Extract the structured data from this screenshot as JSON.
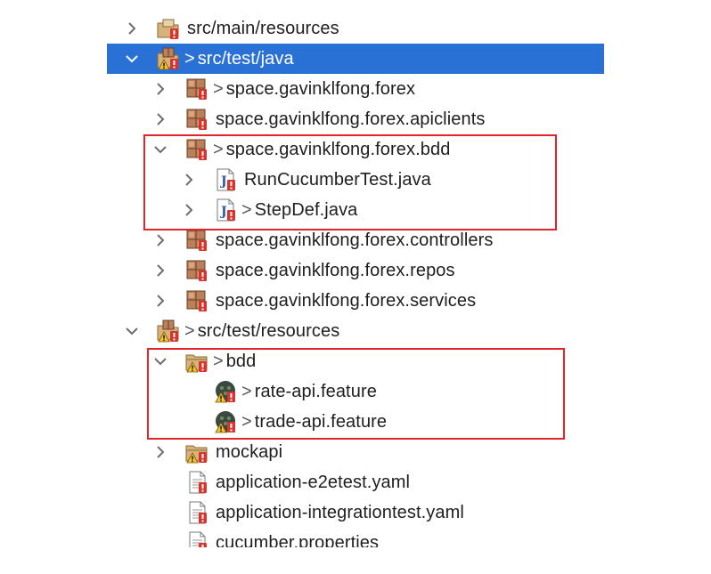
{
  "tree": {
    "rows": [
      {
        "label": "src/main/resources",
        "prefix": "",
        "chevron": "right",
        "icon": "folder-resources-icon",
        "depth": 1,
        "selected": false
      },
      {
        "label": "src/test/java",
        "prefix": ">",
        "chevron": "down",
        "icon": "source-folder-icon",
        "depth": 1,
        "selected": true
      },
      {
        "label": "space.gavinklfong.forex",
        "prefix": ">",
        "chevron": "right",
        "icon": "package-icon",
        "depth": 2,
        "selected": false
      },
      {
        "label": "space.gavinklfong.forex.apiclients",
        "prefix": "",
        "chevron": "right",
        "icon": "package-icon",
        "depth": 2,
        "selected": false
      },
      {
        "label": "space.gavinklfong.forex.bdd",
        "prefix": ">",
        "chevron": "down",
        "icon": "package-icon",
        "depth": 2,
        "selected": false
      },
      {
        "label": "RunCucumberTest.java",
        "prefix": "",
        "chevron": "right",
        "icon": "java-file-icon",
        "depth": 3,
        "selected": false
      },
      {
        "label": "StepDef.java",
        "prefix": ">",
        "chevron": "right",
        "icon": "java-file-icon",
        "depth": 3,
        "selected": false
      },
      {
        "label": "space.gavinklfong.forex.controllers",
        "prefix": "",
        "chevron": "right",
        "icon": "package-icon",
        "depth": 2,
        "selected": false
      },
      {
        "label": "space.gavinklfong.forex.repos",
        "prefix": "",
        "chevron": "right",
        "icon": "package-icon",
        "depth": 2,
        "selected": false
      },
      {
        "label": "space.gavinklfong.forex.services",
        "prefix": "",
        "chevron": "right",
        "icon": "package-icon",
        "depth": 2,
        "selected": false
      },
      {
        "label": "src/test/resources",
        "prefix": ">",
        "chevron": "down",
        "icon": "source-folder-icon",
        "depth": 1,
        "selected": false
      },
      {
        "label": "bdd",
        "prefix": ">",
        "chevron": "down",
        "icon": "folder-icon",
        "depth": 2,
        "selected": false
      },
      {
        "label": "rate-api.feature",
        "prefix": ">",
        "chevron": "none",
        "icon": "cucumber-feature-icon",
        "depth": 3,
        "selected": false
      },
      {
        "label": "trade-api.feature",
        "prefix": ">",
        "chevron": "none",
        "icon": "cucumber-feature-icon",
        "depth": 3,
        "selected": false
      },
      {
        "label": "mockapi",
        "prefix": "",
        "chevron": "right",
        "icon": "folder-icon",
        "depth": 2,
        "selected": false
      },
      {
        "label": "application-e2etest.yaml",
        "prefix": "",
        "chevron": "none",
        "icon": "text-file-icon",
        "depth": 2,
        "selected": false
      },
      {
        "label": "application-integrationtest.yaml",
        "prefix": "",
        "chevron": "none",
        "icon": "text-file-icon",
        "depth": 2,
        "selected": false
      },
      {
        "label": "cucumber.properties",
        "prefix": "",
        "chevron": "none",
        "icon": "text-file-icon",
        "depth": 2,
        "selected": false
      }
    ]
  },
  "colors": {
    "selection": "#2a71d6",
    "highlight_box": "#e0262b",
    "error_badge": "#d9342b",
    "package": "#8b5a3c",
    "folder": "#c9a36a",
    "cucumber": "#3b4a3c"
  }
}
